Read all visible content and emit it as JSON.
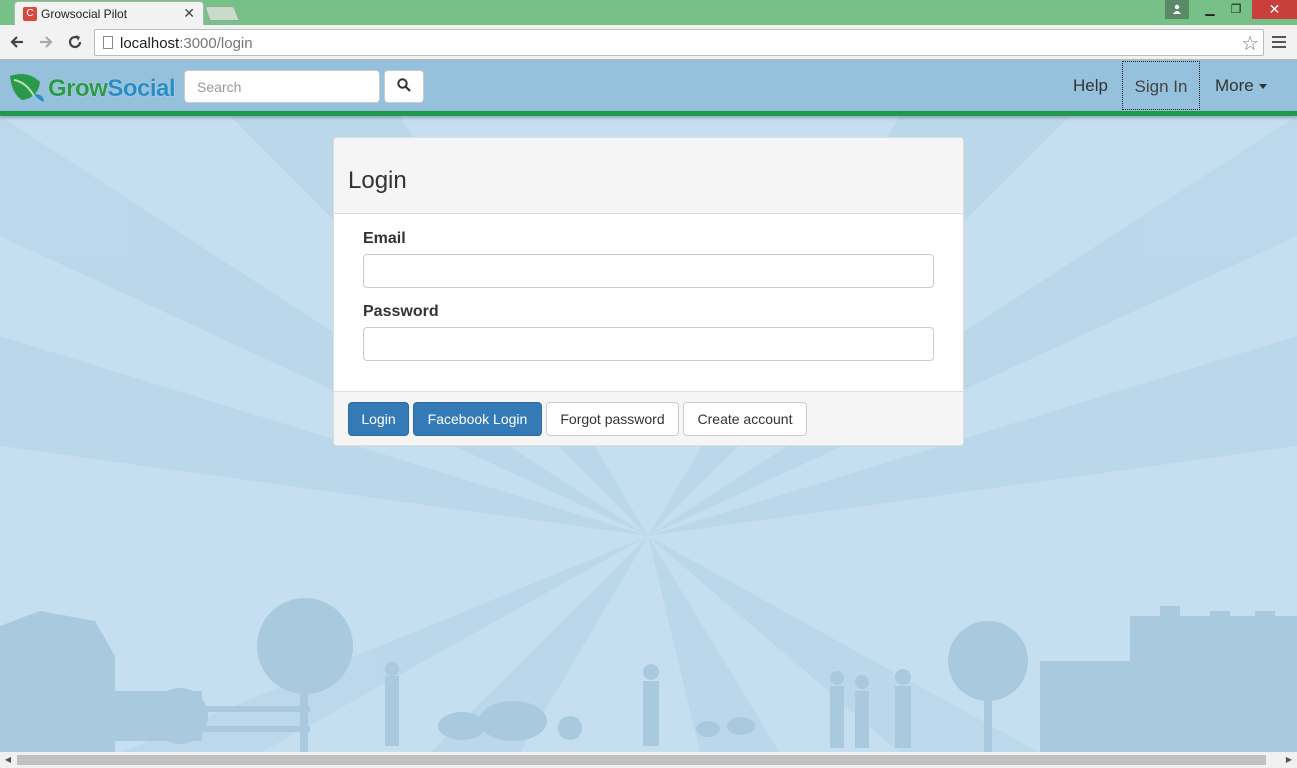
{
  "browser": {
    "tab_title": "Growsocial Pilot",
    "tab_favicon": "C",
    "url_host": "localhost",
    "url_path": ":3000/login"
  },
  "navbar": {
    "logo_grow": "Grow",
    "logo_social": "Social",
    "search_placeholder": "Search",
    "links": {
      "help": "Help",
      "sign_in": "Sign In",
      "more": "More"
    }
  },
  "login": {
    "title": "Login",
    "email_label": "Email",
    "email_value": "",
    "password_label": "Password",
    "password_value": "",
    "buttons": {
      "login": "Login",
      "facebook_login": "Facebook Login",
      "forgot_password": "Forgot password",
      "create_account": "Create account"
    }
  },
  "colors": {
    "titlebar": "#77c087",
    "navbar": "#95c1dc",
    "navbar_accent": "#1e9b49",
    "primary": "#337ab7",
    "background": "#c5dff0"
  }
}
